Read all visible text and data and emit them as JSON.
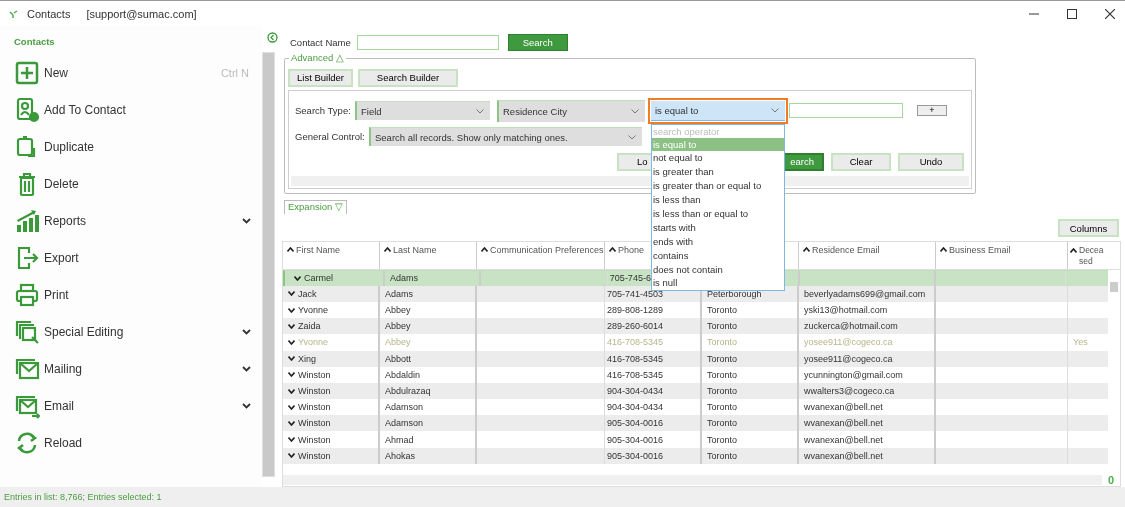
{
  "window": {
    "title": "Contacts",
    "account": "[support@sumac.com]"
  },
  "sidebar": {
    "heading": "Contacts",
    "items": [
      {
        "kind": "new",
        "label": "New",
        "shortcut": "Ctrl N",
        "has_submenu": false
      },
      {
        "kind": "add",
        "label": "Add To Contact",
        "has_submenu": false
      },
      {
        "kind": "duplicate",
        "label": "Duplicate",
        "has_submenu": false
      },
      {
        "kind": "delete",
        "label": "Delete",
        "has_submenu": false
      },
      {
        "kind": "reports",
        "label": "Reports",
        "has_submenu": true
      },
      {
        "kind": "export",
        "label": "Export",
        "has_submenu": false
      },
      {
        "kind": "print",
        "label": "Print",
        "has_submenu": false
      },
      {
        "kind": "special",
        "label": "Special Editing",
        "has_submenu": true
      },
      {
        "kind": "mailing",
        "label": "Mailing",
        "has_submenu": true
      },
      {
        "kind": "email",
        "label": "Email",
        "has_submenu": true
      },
      {
        "kind": "reload",
        "label": "Reload",
        "has_submenu": false
      }
    ]
  },
  "search": {
    "contact_name_label": "Contact Name",
    "search_button": "Search",
    "advanced": {
      "label": "Advanced △",
      "builders": [
        "List Builder",
        "Search Builder"
      ],
      "search_type_label": "Search Type:",
      "search_type": "Field",
      "field": "Residence City",
      "operator": {
        "value": "is equal to",
        "open": true,
        "placeholder": "search operator",
        "options": [
          {
            "label": "is equal to",
            "selected": true
          },
          {
            "label": "not equal to",
            "selected": false
          },
          {
            "label": "is greater than",
            "selected": false
          },
          {
            "label": "is greater than or equal to",
            "selected": false
          },
          {
            "label": "is less than",
            "selected": false
          },
          {
            "label": "is less than or equal to",
            "selected": false
          },
          {
            "label": "starts with",
            "selected": false
          },
          {
            "label": "ends with",
            "selected": false
          },
          {
            "label": "contains",
            "selected": false
          },
          {
            "label": "does not contain",
            "selected": false
          },
          {
            "label": "is null",
            "selected": false
          }
        ]
      },
      "add_button": "+",
      "general_control_label": "General Control:",
      "general_control": "Search all records. Show only matching ones.",
      "actions": [
        {
          "kind": "load",
          "label": "Lo"
        },
        {
          "kind": "search",
          "label": "earch"
        },
        {
          "kind": "clear",
          "label": "Clear"
        },
        {
          "kind": "undo",
          "label": "Undo"
        }
      ]
    },
    "expansion_label": "Expansion ▽"
  },
  "columns_button": "Columns",
  "table": {
    "headers": {
      "first_name": "First Name",
      "last_name": "Last Name",
      "communication_preferences": "Communication Preferences",
      "phone": "Phone",
      "residence_email": "Residence Email",
      "business_email": "Business Email",
      "deceased": "Deceased"
    },
    "rows": [
      {
        "first_name": "Carmel",
        "last_name": "Adams",
        "phone": "705-745-6",
        "selected": true,
        "inactive": false
      },
      {
        "first_name": "Jack",
        "last_name": "Adams",
        "phone": "705-741-4503",
        "city": "Peterborough",
        "residence_email": "beverlyadams699@gmail.com",
        "selected": false,
        "inactive": false
      },
      {
        "first_name": "Yvonne",
        "last_name": "Abbey",
        "phone": "289-808-1289",
        "city": "Toronto",
        "residence_email": "yski13@hotmail.com",
        "selected": false,
        "inactive": false
      },
      {
        "first_name": "Zaida",
        "last_name": "Abbey",
        "phone": "289-260-6014",
        "city": "Toronto",
        "residence_email": "zuckerca@hotmail.com",
        "selected": false,
        "inactive": false
      },
      {
        "first_name": "Yvonne",
        "last_name": "Abbey",
        "phone": "416-708-5345",
        "city": "Toronto",
        "residence_email": "yosee911@cogeco.ca",
        "deceased": "Yes",
        "selected": false,
        "inactive": true
      },
      {
        "first_name": "Xing",
        "last_name": "Abbott",
        "phone": "416-708-5345",
        "city": "Toronto",
        "residence_email": "yosee911@cogeco.ca",
        "selected": false,
        "inactive": false
      },
      {
        "first_name": "Winston",
        "last_name": "Abdaldin",
        "phone": "416-708-5345",
        "city": "Toronto",
        "residence_email": "ycunnington@gmail.com",
        "selected": false,
        "inactive": false
      },
      {
        "first_name": "Winston",
        "last_name": "Abdulrazaq",
        "phone": "904-304-0434",
        "city": "Toronto",
        "residence_email": "wwalters3@cogeco.ca",
        "selected": false,
        "inactive": false
      },
      {
        "first_name": "Winston",
        "last_name": "Adamson",
        "phone": "904-304-0434",
        "city": "Toronto",
        "residence_email": "wvanexan@bell.net",
        "selected": false,
        "inactive": false
      },
      {
        "first_name": "Winston",
        "last_name": "Adamson",
        "phone": "905-304-0016",
        "city": "Toronto",
        "residence_email": "wvanexan@bell.net",
        "selected": false,
        "inactive": false
      },
      {
        "first_name": "Winston",
        "last_name": "Ahmad",
        "phone": "905-304-0016",
        "city": "Toronto",
        "residence_email": "wvanexan@bell.net",
        "selected": false,
        "inactive": false
      },
      {
        "first_name": "Winston",
        "last_name": "Ahokas",
        "phone": "905-304-0016",
        "city": "Toronto",
        "residence_email": "wvanexan@bell.net",
        "selected": false,
        "inactive": false
      }
    ],
    "corner_count": "0"
  },
  "status_bar": "Entries in list: 8,766; Entries selected: 1"
}
